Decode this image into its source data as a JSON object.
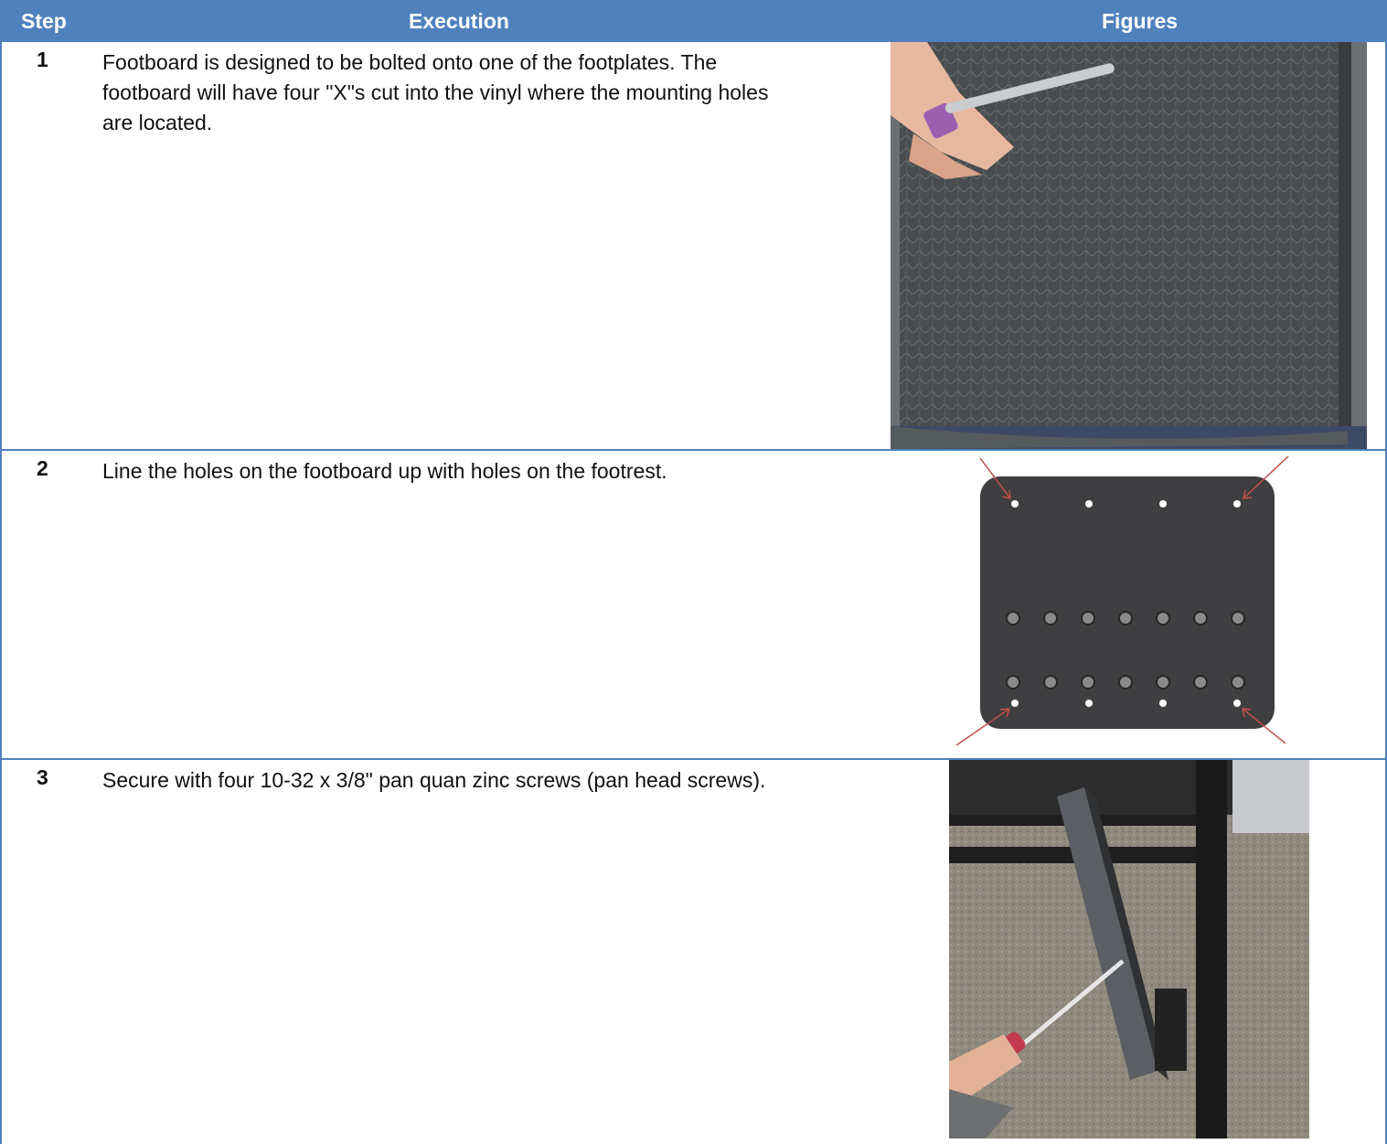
{
  "table": {
    "headers": {
      "step": "Step",
      "execution": "Execution",
      "figures": "Figures"
    },
    "rows": [
      {
        "step": "1",
        "execution": "Footboard is designed to be bolted onto one of the footplates. The footboard will have four \"X\"s cut into the vinyl where the mounting holes are located."
      },
      {
        "step": "2",
        "execution": "Line the holes on the footboard up with holes on the footrest."
      },
      {
        "step": "3",
        "execution": "Secure with four 10-32 x 3/8\" pan quan zinc screws (pan head screws)."
      }
    ]
  },
  "colors": {
    "header_bg": "#4f81bd",
    "header_text": "#ffffff",
    "arrow": "#c0504d"
  }
}
